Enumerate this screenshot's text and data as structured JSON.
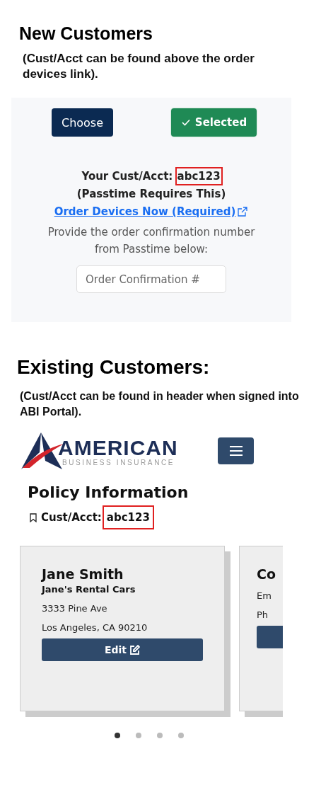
{
  "new_customers": {
    "heading": "New Customers",
    "note": "(Cust/Acct can be found above the order devices link).",
    "panel": {
      "buttons": [
        {
          "label": "Choose",
          "kind": "choose",
          "selected": false
        },
        {
          "label": "Selected",
          "kind": "selected",
          "selected": true
        }
      ],
      "account_label": "Your Cust/Acct:",
      "account_value": "abc123",
      "account_highlighted": true,
      "account_suffix": "(Passtime Requires This)",
      "link": "Order Devices Now (Required)",
      "instructions": "Provide the order confirmation number from Passtime below:",
      "confirmation_field": {
        "placeholder": "Order Confirmation #"
      }
    }
  },
  "existing_customers": {
    "heading": "Existing Customers:",
    "note": "(Cust/Acct can be found in header when signed into ABI Portal).",
    "portal": {
      "logo": {
        "name": "AMERICAN",
        "tagline": "BUSINESS INSURANCE"
      },
      "title": "Policy Information",
      "account_label": "Cust/Acct:",
      "account_value": "abc123",
      "account_highlighted": true,
      "cards": [
        {
          "name": "Jane Smith",
          "company": "Jane's Rental Cars",
          "lines": [
            "3333 Pine Ave",
            "Los Angeles, CA 90210"
          ],
          "button": "Edit"
        },
        {
          "name": "Co",
          "lines": [
            "Em",
            "Ph"
          ]
        }
      ],
      "dots": [
        {
          "selected": true
        },
        {
          "selected": false
        },
        {
          "selected": false
        },
        {
          "selected": false
        }
      ]
    }
  }
}
